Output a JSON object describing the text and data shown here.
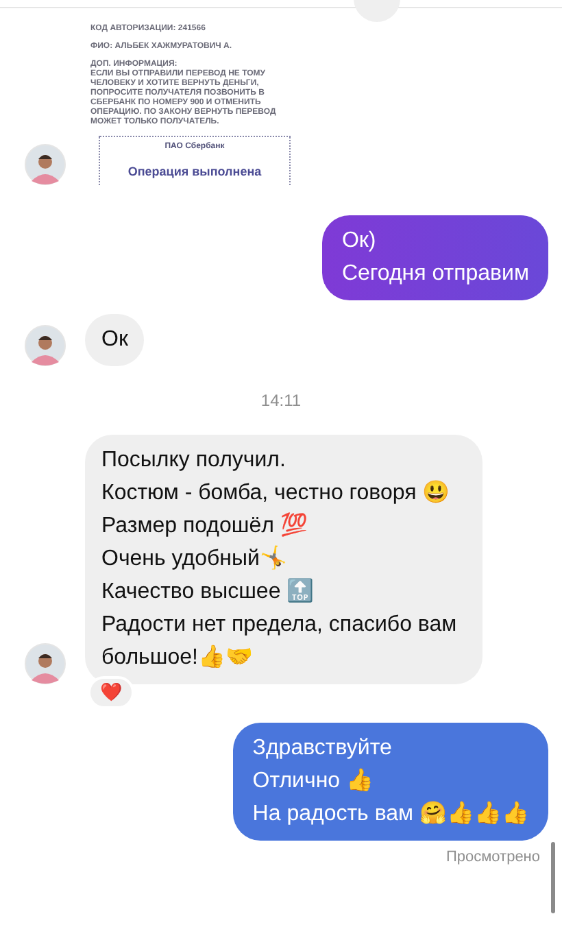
{
  "receipt": {
    "lines": [
      "КОД АВТОРИЗАЦИИ: 241566",
      "ФИО: АЛЬБЕК ХАЖМУРАТОВИЧ А.",
      "ДОП. ИНФОРМАЦИЯ:\nЕСЛИ ВЫ ОТПРАВИЛИ ПЕРЕВОД НЕ ТОМУ\nЧЕЛОВЕКУ И ХОТИТЕ ВЕРНУТЬ ДЕНЬГИ,\nПОПРОСИТЕ ПОЛУЧАТЕЛЯ ПОЗВОНИТЬ В\nСБЕРБАНК ПО НОМЕРУ 900 И ОТМЕНИТЬ\nОПЕРАЦИЮ. ПО ЗАКОНУ ВЕРНУТЬ ПЕРЕВОД\nМОЖЕТ ТОЛЬКО ПОЛУЧАТЕЛЬ."
    ],
    "stamp_bank": "ПАО Сбербанк",
    "stamp_status": "Операция выполнена"
  },
  "messages": [
    {
      "kind": "outgoing",
      "text": "Ок)\nСегодня отправим"
    },
    {
      "kind": "incoming",
      "text": "Ок"
    },
    {
      "kind": "time",
      "text": "14:11"
    },
    {
      "kind": "incoming",
      "text": "Посылку получил.\nКостюм - бомба, честно говоря 😃\nРазмер подошёл 💯\nОчень удобный🤸\nКачество высшее 🔝\nРадости нет предела, спасибо вам большое!👍🤝",
      "reaction": "❤️"
    },
    {
      "kind": "outgoing",
      "text": "Здравствуйте\nОтлично 👍\nНа радость вам 🤗👍👍👍"
    }
  ],
  "seen": "Просмотрено"
}
